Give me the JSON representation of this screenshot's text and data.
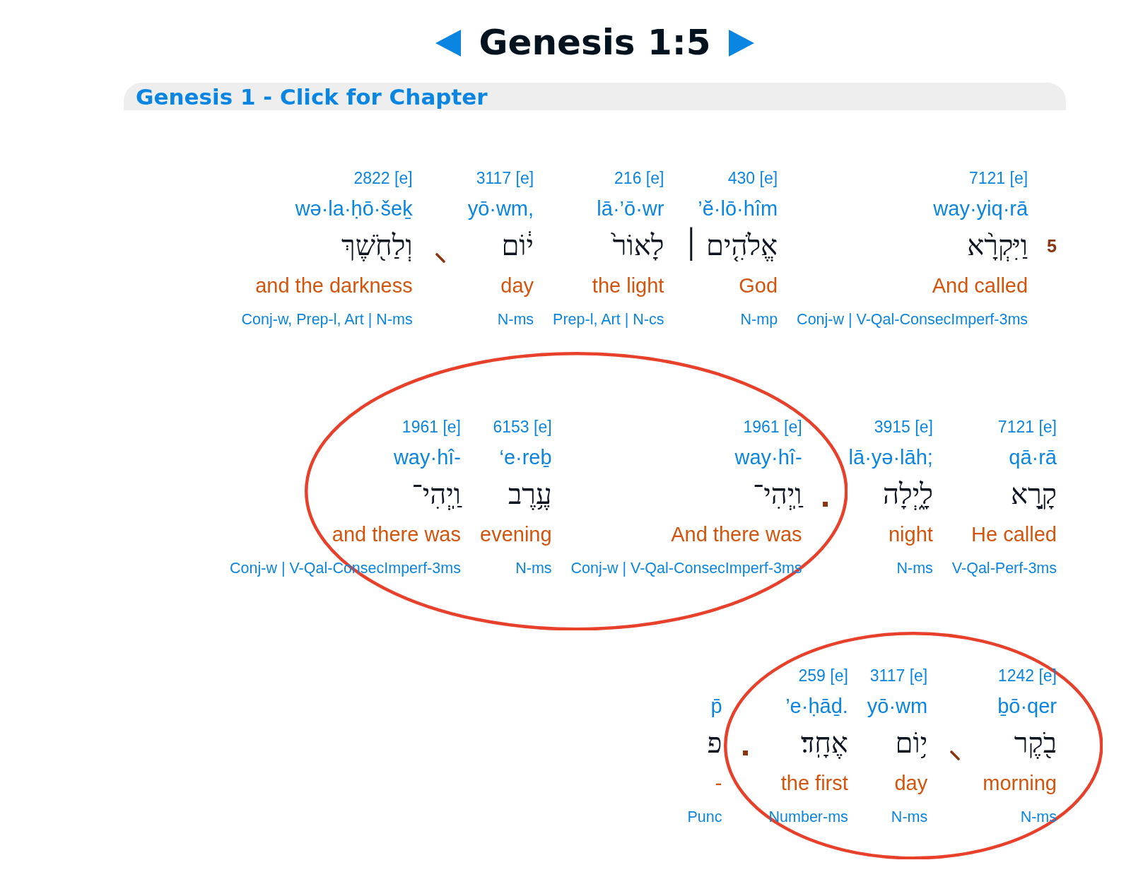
{
  "title": "Genesis 1:5",
  "chapter_link": "Genesis 1 - Click for Chapter",
  "lines": [
    {
      "hebrew": [
        {
          "kind": "verse_number",
          "text": "5"
        },
        {
          "kind": "word",
          "text": "וַיִּקְרָ֨א"
        },
        {
          "kind": "word",
          "text": "אֱלֹהִ֤ים ׀"
        },
        {
          "kind": "word",
          "text": "לָאוֹר֙"
        },
        {
          "kind": "word",
          "text": "י֔וֹם"
        },
        {
          "kind": "comma"
        },
        {
          "kind": "word",
          "text": "וְלַחֹ֖שֶׁךְ"
        }
      ],
      "glosses": [
        {
          "strongs": "2822 [e]",
          "translit": "wə·la·ḥō·šeḵ",
          "english": "and the darkness",
          "parsing": "Conj-w, Prep-l, Art | N-ms"
        },
        {
          "strongs": "3117 [e]",
          "translit": "yō·wm,",
          "english": "day",
          "parsing": "N-ms"
        },
        {
          "strongs": "216 [e]",
          "translit": "lā·’ō·wr",
          "english": "the light",
          "parsing": "Prep-l, Art | N-cs"
        },
        {
          "strongs": "430 [e]",
          "translit": "’ĕ·lō·hîm",
          "english": "God",
          "parsing": "N-mp"
        },
        {
          "strongs": "7121 [e]",
          "translit": "way·yiq·rā",
          "english": "And called",
          "parsing": "Conj-w | V-Qal-ConsecImperf-3ms"
        }
      ]
    },
    {
      "hebrew": [
        {
          "kind": "word",
          "text": "קָ֣רָא"
        },
        {
          "kind": "word",
          "text": "לָ֑יְלָה"
        },
        {
          "kind": "period"
        },
        {
          "kind": "word",
          "text": "וַֽיְהִי־"
        },
        {
          "kind": "word",
          "text": "עֶ֥רֶב"
        },
        {
          "kind": "word",
          "text": "וַֽיְהִי־"
        }
      ],
      "glosses": [
        {
          "strongs": "1961 [e]",
          "translit": "way·hî-",
          "english": "and there was",
          "parsing": "Conj-w | V-Qal-ConsecImperf-3ms"
        },
        {
          "strongs": "6153 [e]",
          "translit": "‘e·reḇ",
          "english": "evening",
          "parsing": "N-ms"
        },
        {
          "strongs": "1961 [e]",
          "translit": "way·hî-",
          "english": "And there was",
          "parsing": "Conj-w | V-Qal-ConsecImperf-3ms"
        },
        {
          "strongs": "3915 [e]",
          "translit": "lā·yə·lāh;",
          "english": "night",
          "parsing": "N-ms"
        },
        {
          "strongs": "7121 [e]",
          "translit": "qā·rā",
          "english": "He called",
          "parsing": "V-Qal-Perf-3ms"
        }
      ]
    },
    {
      "hebrew": [
        {
          "kind": "word",
          "text": "בֹ֖קֶר"
        },
        {
          "kind": "comma"
        },
        {
          "kind": "word",
          "text": "י֥וֹם"
        },
        {
          "kind": "word",
          "text": "אֶחָֽד׃"
        },
        {
          "kind": "period"
        },
        {
          "kind": "word",
          "text": "פ"
        }
      ],
      "glosses": [
        {
          "translit": "p̄",
          "english": "-",
          "parsing": "Punc"
        },
        {
          "strongs": "259 [e]",
          "translit": "’e·ḥāḏ.",
          "english": "the first",
          "parsing": "Number-ms"
        },
        {
          "strongs": "3117 [e]",
          "translit": "yō·wm",
          "english": "day",
          "parsing": "N-ms"
        },
        {
          "strongs": "1242 [e]",
          "translit": "ḇō·qer",
          "english": "morning",
          "parsing": "N-ms"
        }
      ]
    }
  ],
  "annotations": [
    {
      "kind": "ellipse"
    },
    {
      "kind": "ellipse"
    }
  ]
}
